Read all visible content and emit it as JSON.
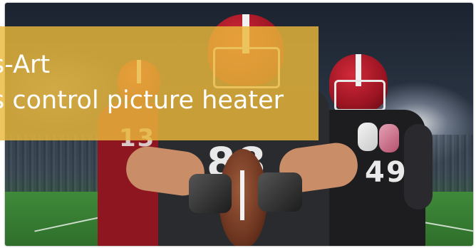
{
  "caption": {
    "line1": "s-Art",
    "line2": "s control picture heater"
  },
  "players": {
    "left_number": "13",
    "center_number": "88",
    "right_number": "49"
  },
  "colors": {
    "caption_overlay": "#eab83a",
    "helmet": "#b01c2a",
    "field": "#2e6d2a"
  }
}
